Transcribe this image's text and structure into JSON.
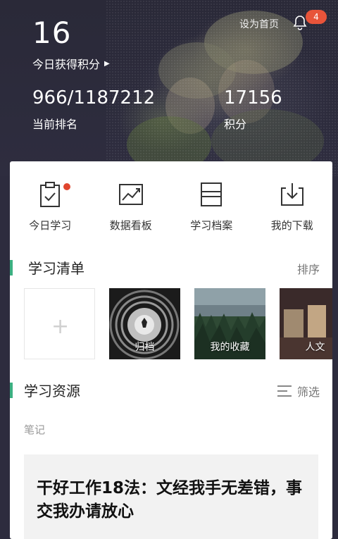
{
  "header": {
    "points": "16",
    "today_points_label": "今日获得积分",
    "set_home_label": "设为首页",
    "notification_count": "4",
    "rank_value": "966/1187212",
    "rank_label": "当前排名",
    "score_value": "17156",
    "score_label": "积分"
  },
  "actions": [
    {
      "label": "今日学习",
      "icon": "clipboard-check-icon",
      "has_dot": true
    },
    {
      "label": "数据看板",
      "icon": "chart-trend-icon",
      "has_dot": false
    },
    {
      "label": "学习档案",
      "icon": "archive-folder-icon",
      "has_dot": false
    },
    {
      "label": "我的下载",
      "icon": "download-tray-icon",
      "has_dot": false
    }
  ],
  "study_list": {
    "title": "学习清单",
    "sort_label": "排序",
    "items": [
      {
        "label": "",
        "type": "add"
      },
      {
        "label": "归档",
        "type": "tunnel"
      },
      {
        "label": "我的收藏",
        "type": "forest"
      },
      {
        "label": "人文",
        "type": "room"
      }
    ]
  },
  "resources": {
    "title": "学习资源",
    "filter_label": "筛选",
    "sub_label": "笔记",
    "article": {
      "title": "干好工作18法：文经我手无差错，事交我办请放心"
    }
  },
  "colors": {
    "accent_green": "#3cb082",
    "badge_red": "#e8543a"
  }
}
